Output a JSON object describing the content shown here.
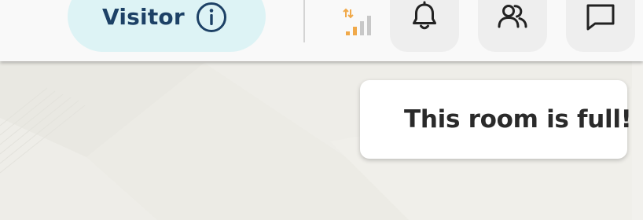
{
  "topbar": {
    "visitor_label": "Visitor",
    "info_icon": "info-icon",
    "signal_icon": "network-signal-icon",
    "buttons": [
      {
        "icon": "bell-icon"
      },
      {
        "icon": "users-icon"
      },
      {
        "icon": "chat-icon"
      }
    ]
  },
  "toast": {
    "message": "This room is full!"
  },
  "colors": {
    "visitor_pill_bg": "#ddf3f5",
    "visitor_text": "#1d4166",
    "signal_orange": "#f0a94a",
    "signal_gray": "#c8c8c8",
    "button_bg": "#eeeeee",
    "icon_stroke": "#222222",
    "canvas_bg": "#eeede8"
  }
}
